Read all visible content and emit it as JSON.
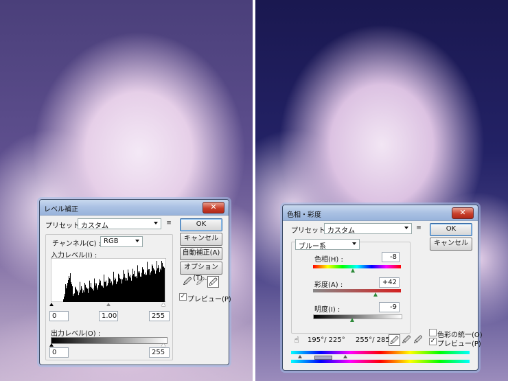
{
  "levels": {
    "title": "レベル補正",
    "preset_label": "プリセット(E) :",
    "preset_value": "カスタム",
    "channel_label": "チャンネル(C) :",
    "channel_value": "RGB",
    "input_levels_label": "入力レベル(I) :",
    "input_black": "0",
    "input_gamma": "1.00",
    "input_white": "255",
    "output_levels_label": "出力レベル(O) :",
    "output_black": "0",
    "output_white": "255",
    "ok_label": "OK",
    "cancel_label": "キャンセル",
    "auto_label": "自動補正(A)",
    "options_label": "オプション(T)...",
    "preview_label": "プレビュー(P)",
    "preview_checked": true
  },
  "hue_sat": {
    "title": "色相・彩度",
    "preset_label": "プリセット(E) :",
    "preset_value": "カスタム",
    "edit_value": "ブルー系",
    "hue_label": "色相(H) :",
    "hue_value": "-8",
    "saturation_label": "彩度(A) :",
    "saturation_value": "+42",
    "lightness_label": "明度(I) :",
    "lightness_value": "-9",
    "range_left": "195°/ 225°",
    "range_right": "255°/ 285°",
    "ok_label": "OK",
    "cancel_label": "キャンセル",
    "colorize_label": "色彩の統一(O)",
    "colorize_checked": false,
    "preview_label": "プレビュー(P)",
    "preview_checked": true
  },
  "icons": {
    "close": "close-icon",
    "menu": "options-menu-icon",
    "eyedropper": "eyedropper-icon",
    "hand": "hand-adjust-icon"
  }
}
